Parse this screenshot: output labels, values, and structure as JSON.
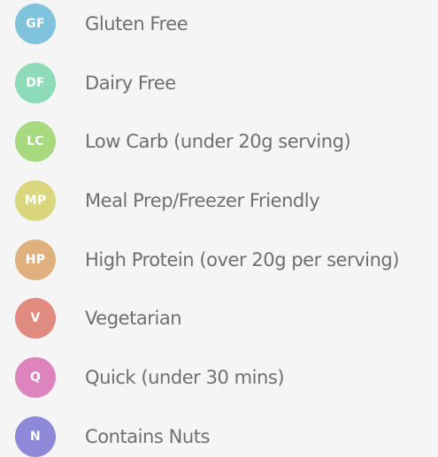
{
  "legend": {
    "items": [
      {
        "code": "GF",
        "label": "Gluten Free",
        "color": "#7fc3dd"
      },
      {
        "code": "DF",
        "label": "Dairy Free",
        "color": "#8ddbb9"
      },
      {
        "code": "LC",
        "label": "Low Carb (under 20g serving)",
        "color": "#a7d97e"
      },
      {
        "code": "MP",
        "label": "Meal Prep/Freezer Friendly",
        "color": "#d9d67e"
      },
      {
        "code": "HP",
        "label": "High Protein (over 20g per serving)",
        "color": "#e0b07e"
      },
      {
        "code": "V",
        "label": "Vegetarian",
        "color": "#e08a80"
      },
      {
        "code": "Q",
        "label": "Quick (under 30 mins)",
        "color": "#dd83bd"
      },
      {
        "code": "N",
        "label": "Contains Nuts",
        "color": "#8e88d8"
      }
    ]
  }
}
